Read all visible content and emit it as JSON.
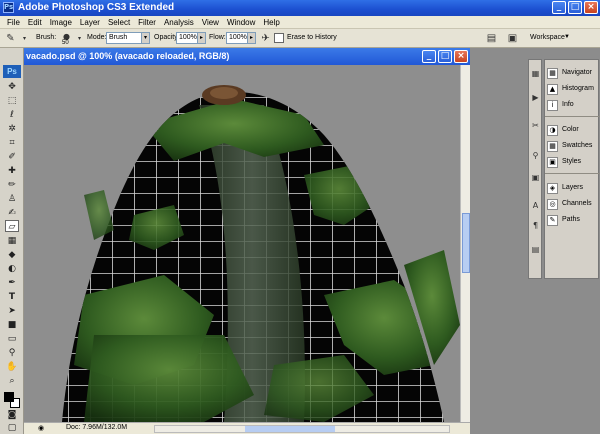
{
  "app": {
    "title": "Adobe Photoshop CS3 Extended",
    "logo": "Ps"
  },
  "menu": [
    "File",
    "Edit",
    "Image",
    "Layer",
    "Select",
    "Filter",
    "Analysis",
    "View",
    "Window",
    "Help"
  ],
  "options": {
    "brush_label": "Brush:",
    "brush_size": "50",
    "mode_label": "Mode:",
    "mode_value": "Brush",
    "opacity_label": "Opacity:",
    "opacity_value": "100%",
    "flow_label": "Flow:",
    "flow_value": "100%",
    "erase_history_label": "Erase to History",
    "workspace_label": "Workspace"
  },
  "document": {
    "title": "vacado.psd @ 100% (avacado reloaded, RGB/8)",
    "status": "Doc: 7.96M/132.0M"
  },
  "panels": {
    "group1": [
      "Navigator",
      "Histogram",
      "Info"
    ],
    "group2": [
      "Color",
      "Swatches",
      "Styles"
    ],
    "group3": [
      "Layers",
      "Channels",
      "Paths"
    ]
  },
  "colors": {
    "titlebar": "#2158d6",
    "foreground_swatch": "#000000",
    "background_swatch": "#ffffff"
  }
}
